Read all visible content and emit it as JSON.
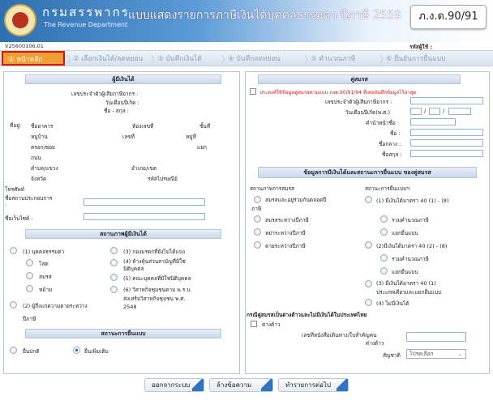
{
  "header": {
    "org_th": "กรมสรรพากร",
    "org_en": "The Revenue Department",
    "title": "แบบแสดงรายการภาษีเงินได้บุคคลธรรมดา ปีภาษี 2559",
    "form_code": "ภ.ง.ด.90/91"
  },
  "doc": {
    "number": "V25600106.01",
    "user_label": "รหัสผู้ใช้ :"
  },
  "steps": [
    "① หน้าหลัก",
    "② เลือกเงินได้/ลดหย่อน",
    "③ บันทึกเงินได้",
    "④ บันทึกลดหย่อน",
    "⑤ คำนวณภาษี",
    "⑥ ยืนยันการยื่นแบบ"
  ],
  "left": {
    "title": "ผู้มีเงินได้",
    "tin": "เลขประจำตัวผู้เสียภาษีอากร :",
    "dob": "วันเดือนปีเกิด :",
    "name": "ชื่อ - สกุล :",
    "address": "ที่อยู่:",
    "building": "ชื่ออาคาร",
    "room": "ห้องเลขที่",
    "floor": "ชั้นที่",
    "village": "หมู่บ้าน",
    "no": "เลขที่",
    "moo": "หมู่ที่",
    "soi": "ตรอก/ซอย",
    "yaek": "แยก",
    "road": "ถนน",
    "subdistrict": "ตำบล/แขวง",
    "district": "อำเภอ/เขต",
    "province": "จังหวัด",
    "postcode": "รหัสไปรษณีย์",
    "phone": "โทรศัพท์",
    "business": "ชื่อสถานประกอบการ",
    "colon": ":",
    "website": "ชื่อเว็บไซต์ :",
    "status_title": "สถานภาพผู้มีเงินได้",
    "s1": "(1) บุคคลธรรมดา",
    "s1a": "โสด",
    "s1b": "สมรส",
    "s1c": "หม้าย",
    "s2": "(2) ผู้ถึงแก่ความตายระหว่าง",
    "s2b": "ปีภาษี",
    "s3": "(3) กองมรดกที่ยังไม่ได้แบ่ง",
    "s4": "(4) ห้างหุ้นส่วนสามัญที่มิใช่",
    "s4b": "นิติบุคคล",
    "s5": "(5) คณะบุคคลที่มิใช่นิติบุคคล",
    "s6": "(6) วิสาหกิจชุมชนตาม พ.ร.บ.",
    "s6b": "ส่งเสริมวิสาหกิจชุมชน พ.ศ.",
    "s6c": "2548",
    "filing_title": "สถานะการยื่นแบบ",
    "f1": "ยื่นปกติ",
    "f2": "ยื่นเพิ่มเติม"
  },
  "right": {
    "title": "คู่สมรส",
    "notice": "ประสงค์ใช้ข้อมูลคู่สมรสตามแบบ ภงด.90/91/94 ที่เคยบันทึกข้อมูลไว้ล่าสุด",
    "tin": "เลขประจำตัวผู้เสียภาษีอากร :",
    "dob": "วันเดือนปีเกิด(พ.ศ.)",
    "prefix": "คำนำหน้าชื่อ :",
    "first": "ชื่อ :",
    "middle": "ชื่อกลาง :",
    "last": "ชื่อสกุล :",
    "income_title": "ข้อมูลการมีเงินได้และสถานะการยื่นแบบ ของคู่สมรส",
    "col_marital": "สถานภาพการสมรส",
    "col_filing": "สถานะการยื่นแบบฯ",
    "m1": "สมรสและอยู่ร่วมกันตลอดปี",
    "m1b": "ภาษี",
    "m2": "สมรสระหว่างปีภาษี",
    "m3": "หย่าระหว่างปีภาษี",
    "m4": "ตายระหว่างปีภาษี",
    "a1": "(1) มีเงินได้มาตรา 40 (1) - (8)",
    "a1a": "รวมคำนวณภาษี",
    "a1b": "แยกยื่นแบบ",
    "a2": "(2)มีเงินได้มาตรา 40 (2) - (8)",
    "a2a": "รวมคำนวณภาษี",
    "a2b": "แยกยื่นแบบ",
    "a3": "(3) มีเงินได้มาตรา 40 (1)",
    "a3b": "ประเภทเดียวและแยกยื่นแบบ",
    "a4": "(4) ไม่มีเงินได้",
    "foreign_title": "กรณีคู่สมรสเป็นต่างด้าวและไม่มีเงินได้ในประเทศไทย",
    "foreign_chk": "ต่างด้าว",
    "passport": "เลขที่หนังสือเดินทาง/ใบสำคัญคน",
    "passport2": "ต่างด้าว",
    "nationality": "สัญชาติ",
    "nat_select": "โปรดเลือก"
  },
  "buttons": {
    "logout": "ออกจากระบบ",
    "clear": "ล้างข้อความ",
    "next": "ทำรายการต่อไป"
  }
}
